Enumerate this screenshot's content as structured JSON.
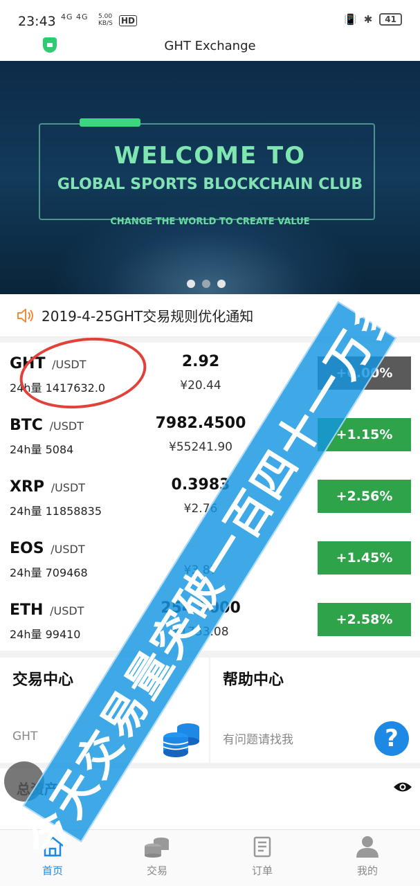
{
  "status_bar": {
    "time": "23:43",
    "network": "4G 4G",
    "speed_value": "5.00",
    "speed_unit": "KB/S",
    "hd": "HD",
    "battery": "41"
  },
  "header": {
    "title": "GHT Exchange",
    "shield_icon": "shield-icon"
  },
  "banner": {
    "line1": "WELCOME  TO",
    "line2": "GLOBAL SPORTS BLOCKCHAIN CLUB",
    "line3": "CHANGE THE WORLD TO CREATE VALUE",
    "slides": 3,
    "active_slide": 0
  },
  "notice": {
    "text": "2019-4-25GHT交易规则优化通知"
  },
  "market": {
    "rows": [
      {
        "symbol": "GHT",
        "quote": "/USDT",
        "volume": "24h量 1417632.0",
        "price": "2.92",
        "cny": "¥20.44",
        "change": "+0.00%",
        "trend": "flat"
      },
      {
        "symbol": "BTC",
        "quote": "/USDT",
        "volume": "24h量 5084",
        "price": "7982.4500",
        "cny": "¥55241.90",
        "change": "+1.15%",
        "trend": "up"
      },
      {
        "symbol": "XRP",
        "quote": "/USDT",
        "volume": "24h量 11858835",
        "price": "0.3983",
        "cny": "¥2.76",
        "change": "+2.56%",
        "trend": "up"
      },
      {
        "symbol": "EOS",
        "quote": "/USDT",
        "volume": "24h量 709468",
        "price": "",
        "cny": "¥3.87",
        "change": "+1.45%",
        "trend": "up"
      },
      {
        "symbol": "ETH",
        "quote": "/USDT",
        "volume": "24h量 99410",
        "price": "254.9000",
        "cny": "¥1753.08",
        "change": "+2.58%",
        "trend": "up"
      }
    ],
    "colors": {
      "up": "#2ea34a",
      "flat": "#5a5a5a"
    }
  },
  "cards": {
    "trade": {
      "title": "交易中心",
      "subtitle": "GHT",
      "icon": "coins-icon"
    },
    "help": {
      "title": "帮助中心",
      "subtitle": "有问题请找我",
      "icon": "question-icon"
    }
  },
  "assets": {
    "label": "总资产",
    "icon": "eye-icon"
  },
  "tabbar": {
    "items": [
      {
        "label": "首页",
        "icon": "home-icon",
        "active": true
      },
      {
        "label": "交易",
        "icon": "coins-icon",
        "active": false
      },
      {
        "label": "订单",
        "icon": "order-icon",
        "active": false
      },
      {
        "label": "我的",
        "icon": "user-icon",
        "active": false
      }
    ]
  },
  "overlay": {
    "text": "今天交易量突破一百四十一万多"
  }
}
